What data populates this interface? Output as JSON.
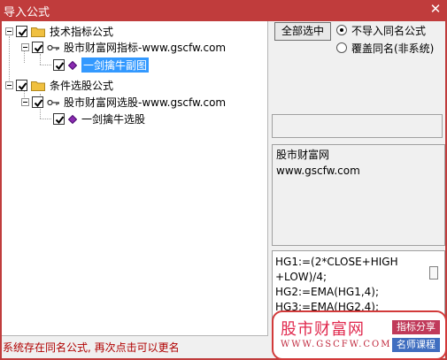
{
  "window": {
    "title": "导入公式",
    "close_glyph": "✕"
  },
  "tree": {
    "nodes": [
      {
        "label": "技术指标公式",
        "checked": true
      },
      {
        "label": "股市财富网指标-www.gscfw.com",
        "checked": true
      },
      {
        "label": "一剑擒牛副图",
        "checked": true,
        "selected": true
      },
      {
        "label": "条件选股公式",
        "checked": true
      },
      {
        "label": "股市财富网选股-www.gscfw.com",
        "checked": true
      },
      {
        "label": "一剑擒牛选股",
        "checked": true
      }
    ]
  },
  "options": {
    "select_all_label": "全部选中",
    "radio_no_import": "不导入同名公式",
    "radio_overwrite": "覆盖同名(非系统)",
    "selected_radio": "no_import"
  },
  "description": {
    "line1": "股市财富网",
    "line2": "www.gscfw.com"
  },
  "formula": {
    "lines": [
      "HG1:=(2*CLOSE+HIGH",
      "+LOW)/4;",
      "HG2:=EMA(HG1,4);",
      "HG3:=EMA(HG2,4);"
    ]
  },
  "status_text": "系统存在同名公式, 再次点击可以更名",
  "watermark": {
    "main": "股市财富网",
    "url": "WWW.GSCFW.COM",
    "tag1": "指标分享",
    "tag2": "名师课程"
  },
  "icons": {
    "folder": "folder-icon",
    "key": "key-icon",
    "formula": "formula-diamond-icon",
    "check": "checkmark-icon",
    "expander": "tree-collapse-icon"
  },
  "colors": {
    "title_bar": "#c03c3c",
    "selection": "#3399ff",
    "status_text": "#b00000",
    "folder": "#f0c040",
    "formula_icon": "#8a2bb0"
  }
}
